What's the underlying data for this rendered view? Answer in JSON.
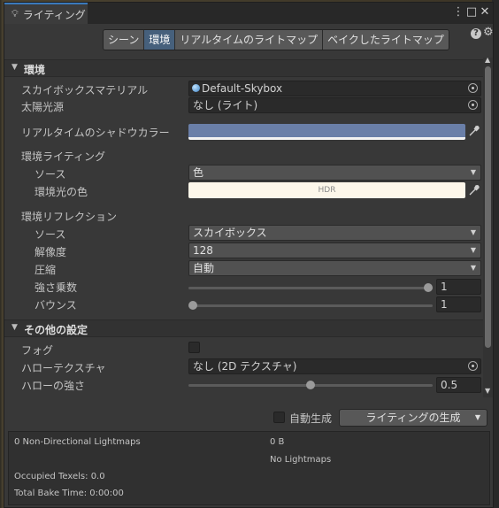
{
  "window": {
    "tab_title": "ライティング",
    "icons": {
      "tab": "lightbulb-icon",
      "menu": "kebab-menu-icon",
      "maximize": "maximize-icon",
      "close": "close-icon"
    }
  },
  "toolbar": {
    "tabs": [
      "シーン",
      "環境",
      "リアルタイムのライトマップ",
      "ベイクしたライトマップ"
    ],
    "active_tab": "環境",
    "icons": {
      "help": "help-icon",
      "settings": "gear-icon"
    }
  },
  "environment": {
    "header": "環境",
    "skybox_label": "スカイボックスマテリアル",
    "skybox_value": "Default-Skybox",
    "sun_label": "太陽光源",
    "sun_value": "なし (ライト)",
    "shadow_color_label": "リアルタイムのシャドウカラー",
    "shadow_color": "#6a7fa8",
    "lighting_group_label": "環境ライティング",
    "lighting_source_label": "ソース",
    "lighting_source_value": "色",
    "ambient_color_label": "環境光の色",
    "ambient_color": "#fdf7ea",
    "ambient_hdr": "HDR",
    "reflection_group_label": "環境リフレクション",
    "reflection_source_label": "ソース",
    "reflection_source_value": "スカイボックス",
    "resolution_label": "解像度",
    "resolution_value": "128",
    "compression_label": "圧縮",
    "compression_value": "自動",
    "intensity_label": "強さ乗数",
    "intensity_value": "1",
    "bounces_label": "バウンス",
    "bounces_value": "1"
  },
  "other": {
    "header": "その他の設定",
    "fog_label": "フォグ",
    "fog_checked": false,
    "halo_texture_label": "ハローテクスチャ",
    "halo_texture_value": "なし (2D テクスチャ)",
    "halo_strength_label": "ハローの強さ",
    "halo_strength_value": "0.5",
    "halo_strength_fraction": 0.5
  },
  "bottom": {
    "auto_generate_label": "自動生成",
    "auto_generate_checked": false,
    "generate_button": "ライティングの生成"
  },
  "stats": {
    "lightmaps": "0 Non-Directional Lightmaps",
    "size": "0 B",
    "no_lightmaps": "No Lightmaps",
    "occupied": "Occupied Texels: 0.0",
    "bake_time": "Total Bake Time: 0:00:00"
  }
}
